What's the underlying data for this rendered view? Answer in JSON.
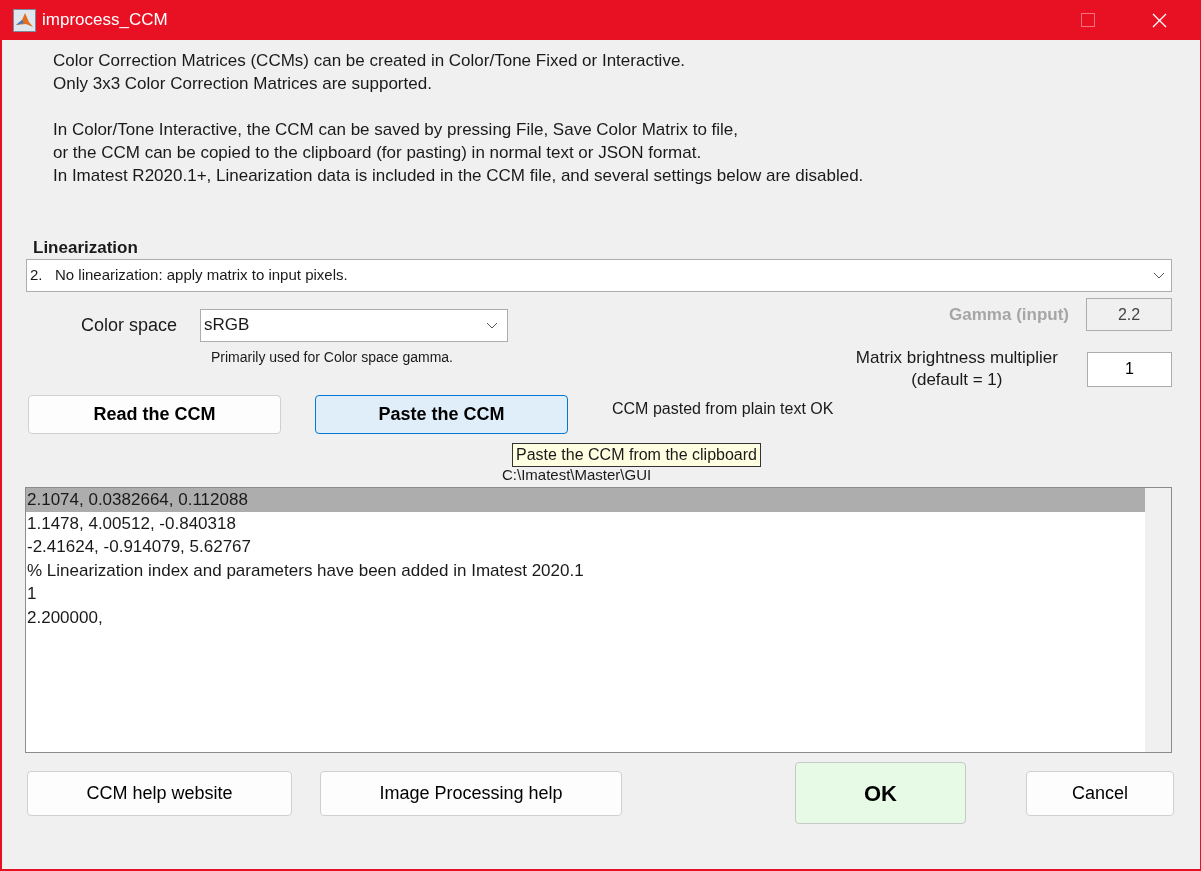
{
  "window": {
    "title": "improcess_CCM"
  },
  "intro": [
    [
      "Color Correction Matrices (CCMs) can be created in Color/Tone Fixed or Interactive.",
      "Only 3x3 Color Correction Matrices are supported."
    ],
    [
      "In Color/Tone Interactive, the CCM can be saved by pressing File, Save Color Matrix to file,",
      "or the CCM can be copied to the clipboard (for pasting) in normal text or JSON format.",
      "In Imatest R2020.1+, Linearization data is included in the CCM file, and several settings below are disabled."
    ]
  ],
  "linearization": {
    "label": "Linearization",
    "value": "2.   No linearization: apply matrix to input pixels."
  },
  "color_space": {
    "label": "Color space",
    "value": "sRGB",
    "note": "Primarily used for Color space gamma."
  },
  "gamma": {
    "label": "Gamma (input)",
    "value": "2.2",
    "disabled": true
  },
  "multiplier": {
    "label": "Matrix brightness multiplier",
    "sublabel": "(default = 1)",
    "value": "1"
  },
  "ccm_buttons": [
    {
      "label": "Read the CCM",
      "hovered": false
    },
    {
      "label": "Paste the CCM",
      "hovered": true
    }
  ],
  "status": "CCM pasted from plain text OK",
  "tooltip": "Paste the CCM from the clipboard",
  "path": "C:\\Imatest\\Master\\GUI",
  "ccm_list": [
    {
      "text": "2.1074, 0.0382664, 0.112088",
      "selected": true
    },
    {
      "text": "1.1478, 4.00512, -0.840318",
      "selected": false
    },
    {
      "text": "-2.41624, -0.914079, 5.62767",
      "selected": false
    },
    {
      "text": "% Linearization index and parameters have been added in Imatest 2020.1",
      "selected": false
    },
    {
      "text": "1",
      "selected": false
    },
    {
      "text": "2.200000,",
      "selected": false
    }
  ],
  "bottom_buttons": [
    {
      "label": "CCM help website",
      "kind": "normal"
    },
    {
      "label": "Image Processing help",
      "kind": "normal"
    },
    {
      "label": "OK",
      "kind": "default"
    },
    {
      "label": "Cancel",
      "kind": "normal"
    }
  ]
}
